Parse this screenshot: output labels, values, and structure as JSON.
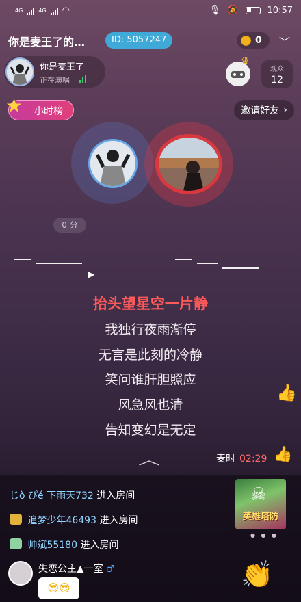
{
  "status_bar": {
    "network_labels": [
      "4G",
      "4G"
    ],
    "time": "10:57"
  },
  "header": {
    "room_title": "你是麦王了的…",
    "room_id": "ID: 5057247",
    "coins": "0"
  },
  "host": {
    "name": "你是麦王了",
    "status": "正在演唱"
  },
  "audience": {
    "label": "观众",
    "count": "12"
  },
  "rank_button": "小时榜",
  "invite_button": "邀请好友",
  "score": "0 分",
  "lyrics": {
    "current": "抬头望星空一片静",
    "next": [
      "我独行夜雨渐停",
      "无言是此刻的冷静",
      "笑问谁肝胆照应",
      "风急风也清",
      "告知变幻是无定"
    ]
  },
  "mic_time": {
    "label": "麦时",
    "time": "02:29"
  },
  "chat": [
    {
      "user": "じò ぴé 下雨天732",
      "action": "进入房间"
    },
    {
      "user": "追梦少年46493",
      "action": "进入房间"
    },
    {
      "user": "帅斌55180",
      "action": "进入房间"
    }
  ],
  "chat_user": {
    "name": "失恋公主▲一室",
    "gender": "♂",
    "emoji": "😎😎"
  },
  "game_banner": {
    "title": "英雄塔防"
  },
  "colors": {
    "id_badge": "#3fa9d8",
    "lyric_current": "#ff5a5a",
    "mic_time": "#ff6b6b",
    "chat_name": "#8fd5ff",
    "singer_ring_left": "#68a8e6",
    "singer_ring_right": "#d9383f"
  },
  "icons": [
    "mic-icon",
    "mute-icon",
    "battery-icon",
    "wifi-icon",
    "chevron-down-icon",
    "coin-icon",
    "crown-icon",
    "star-icon",
    "chevron-right-icon",
    "play-icon",
    "thumbs-up-icon",
    "collapse-icon",
    "clap-icon",
    "skull-icon"
  ]
}
